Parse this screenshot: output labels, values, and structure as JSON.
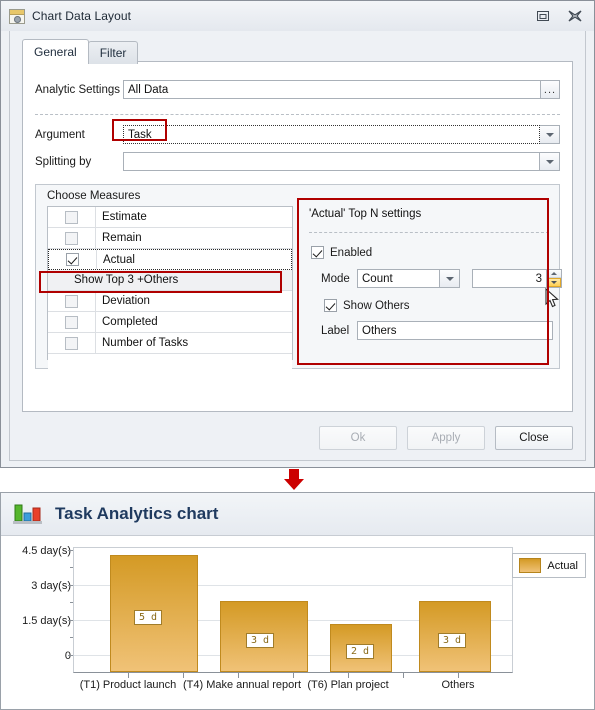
{
  "dialog": {
    "title": "Chart Data Layout",
    "icon": "chart-data-layout-icon",
    "restore_icon": "restore-window-icon",
    "close_icon": "close-window-icon",
    "tabs": [
      {
        "label": "General",
        "active": true
      },
      {
        "label": "Filter",
        "active": false
      }
    ],
    "fields": {
      "analytic_settings_label": "Analytic Settings",
      "analytic_settings_value": "All Data",
      "ellipsis_label": "...",
      "argument_label": "Argument",
      "argument_value": "Task",
      "splitting_label": "Splitting by",
      "splitting_value": ""
    },
    "measures": {
      "group_title": "Choose Measures",
      "rows": [
        {
          "label": "Estimate",
          "checked": false,
          "type": "measure"
        },
        {
          "label": "Remain",
          "checked": false,
          "type": "measure"
        },
        {
          "label": "Actual",
          "checked": true,
          "type": "measure",
          "selected": true
        },
        {
          "label": "Show Top 3 +Others",
          "type": "subrow"
        },
        {
          "label": "Deviation",
          "checked": false,
          "type": "measure"
        },
        {
          "label": "Completed",
          "checked": false,
          "type": "measure"
        },
        {
          "label": "Number of Tasks",
          "checked": false,
          "type": "measure"
        }
      ]
    },
    "topn": {
      "title": "'Actual' Top N settings",
      "enabled_label": "Enabled",
      "enabled_checked": true,
      "mode_label": "Mode",
      "mode_value": "Count",
      "count_value": "3",
      "show_others_label": "Show Others",
      "show_others_checked": true,
      "label_label": "Label",
      "label_value": "Others"
    },
    "buttons": {
      "ok": "Ok",
      "apply": "Apply",
      "close": "Close"
    }
  },
  "flow_arrow": {
    "icon": "red-down-arrow-icon",
    "color": "#cc0000"
  },
  "chart_panel": {
    "icon": "bar-chart-icon",
    "title": "Task Analytics chart"
  },
  "chart_data": {
    "type": "bar",
    "title": "Task Analytics chart",
    "categories": [
      "(T1) Product launch",
      "(T4) Make annual report",
      "(T6) Plan project",
      "Others"
    ],
    "values": [
      5,
      3,
      2,
      3
    ],
    "point_labels": [
      "5 d",
      "3 d",
      "2 d",
      "3 d"
    ],
    "series": [
      {
        "name": "Actual",
        "values": [
          5,
          3,
          2,
          3
        ],
        "color": "#d99f2d"
      }
    ],
    "ytick_labels": [
      "0",
      "1.5 day(s)",
      "3 day(s)",
      "4.5 day(s)"
    ],
    "ytick_values": [
      0,
      1.5,
      3,
      4.5
    ],
    "ylim": [
      0,
      5.4
    ],
    "xlabel": "",
    "ylabel": "",
    "grid": true,
    "legend": {
      "position": "right",
      "entries": [
        "Actual"
      ]
    }
  }
}
